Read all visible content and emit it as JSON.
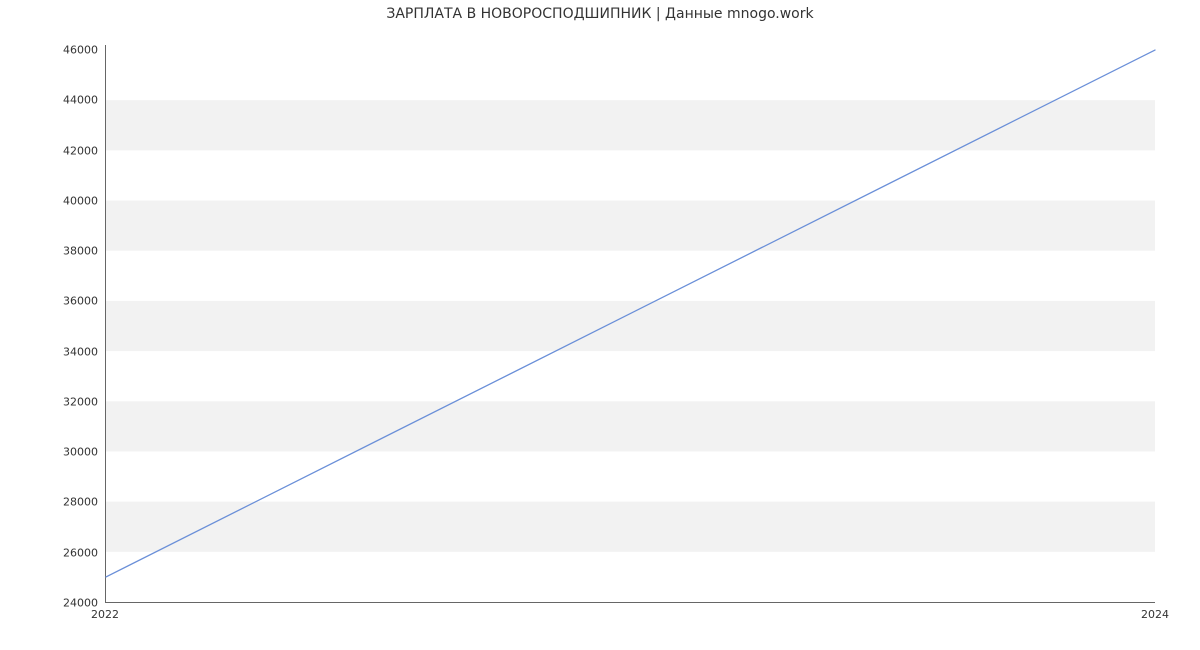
{
  "chart_data": {
    "type": "line",
    "title": "ЗАРПЛАТА В  НОВОРОСПОДШИПНИК | Данные mnogo.work",
    "xlabel": "",
    "ylabel": "",
    "x": [
      2022,
      2024
    ],
    "values": [
      25000,
      46000
    ],
    "x_ticks": [
      2022,
      2024
    ],
    "y_ticks": [
      24000,
      26000,
      28000,
      30000,
      32000,
      34000,
      36000,
      38000,
      40000,
      42000,
      44000,
      46000
    ],
    "xlim": [
      2022,
      2024
    ],
    "ylim": [
      24000,
      46200
    ],
    "line_color": "#6a8fd8",
    "band_color": "#f2f2f2"
  }
}
